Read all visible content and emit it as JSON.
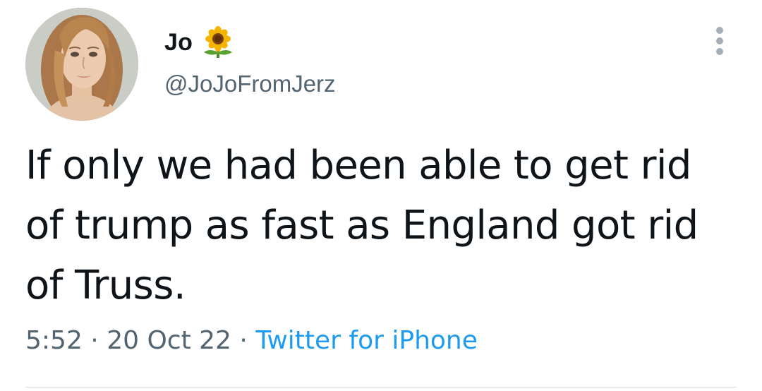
{
  "author": {
    "display_name": "Jo",
    "name_emoji_icon": "sunflower-emoji",
    "handle": "@JoJoFromJerz"
  },
  "tweet": {
    "text": "If only we had been able to get rid of trump as fast as England got rid of Truss.",
    "time": "5:52",
    "separator_1": "·",
    "date": "20 Oct 22",
    "separator_2": "·",
    "source": "Twitter for iPhone"
  },
  "icons": {
    "more": "more-vertical-icon"
  },
  "colors": {
    "text_primary": "#0f1419",
    "text_secondary": "#536471",
    "link": "#1d9bf0",
    "more_dots": "#a4aeb7",
    "divider": "#cfd9de"
  }
}
